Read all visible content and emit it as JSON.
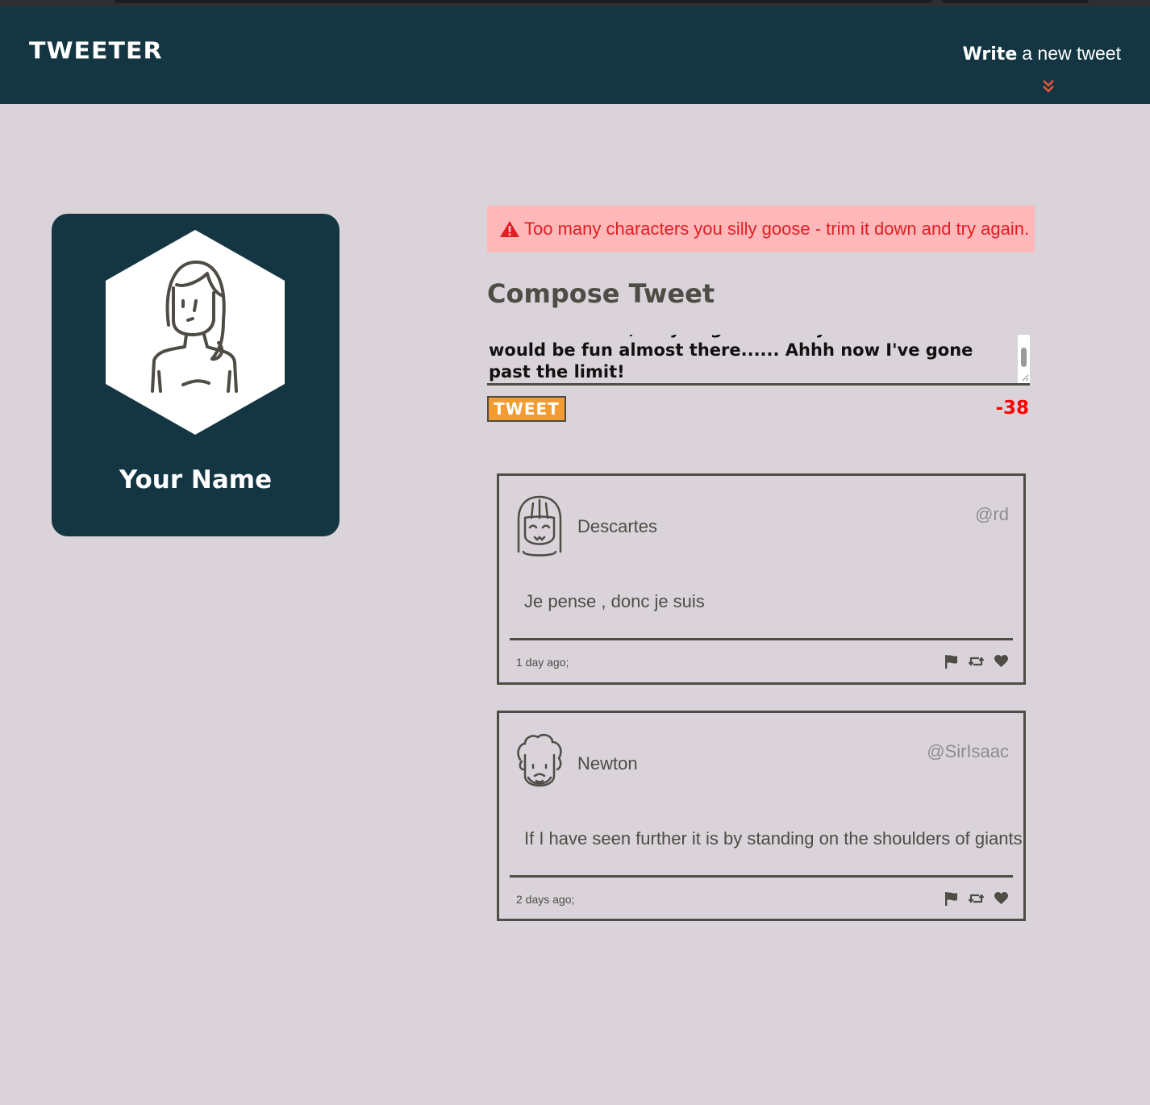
{
  "nav": {
    "logo": "TWEETER",
    "write_strong": "Write",
    "write_rest": "a new tweet"
  },
  "profile": {
    "name": "Your Name"
  },
  "compose": {
    "error": "Too many characters you silly goose - trim it down and try again.",
    "title": "Compose Tweet",
    "text": "characters left, maybe go even beyond that that would be fun almost there...... Ahhh now I've gone past the limit!",
    "button_label": "TWEET",
    "counter": "-38"
  },
  "tweets": [
    {
      "author": "Descartes",
      "handle": "@rd",
      "content": "Je pense , donc je suis",
      "time": "1 day ago;"
    },
    {
      "author": "Newton",
      "handle": "@SirIsaac",
      "content": "If I have seen further it is by standing on the shoulders of giants",
      "time": "2 days ago;"
    }
  ],
  "colors": {
    "nav_bg": "#143643",
    "page_bg": "#dad3da",
    "accent_orange": "#f29b30",
    "error_bg": "#ffb8b9",
    "error_text": "#e01f25",
    "counter_red": "#ff0000",
    "chevron": "#e8553d"
  },
  "icons": {
    "chevron": "double-chevron-down-icon",
    "warning": "warning-triangle-icon",
    "flag": "flag-icon",
    "retweet": "retweet-icon",
    "like": "heart-icon"
  }
}
